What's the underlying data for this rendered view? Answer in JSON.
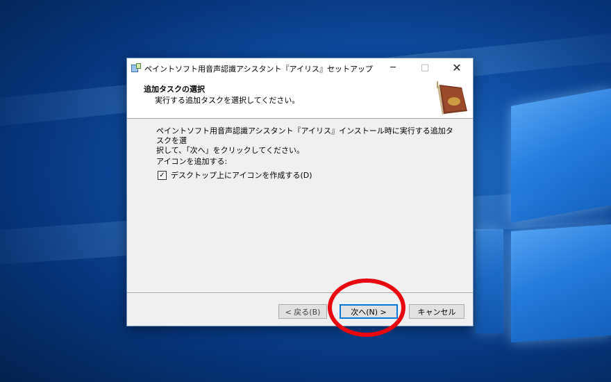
{
  "window": {
    "title": "ペイントソフト用音声認識アシスタント『アイリス』セットアップ",
    "controls": {
      "minimize": "─",
      "maximize": "□",
      "close": "✕"
    }
  },
  "header": {
    "title": "追加タスクの選択",
    "subtitle": "実行する追加タスクを選択してください。"
  },
  "content": {
    "description_line1": "ペイントソフト用音声認識アシスタント『アイリス』インストール時に実行する追加タスクを選",
    "description_line2": "択して、「次へ」をクリックしてください。",
    "section_label": "アイコンを追加する:",
    "checkbox": {
      "label": "デスクトップ上にアイコンを作成する(D)",
      "checked": true,
      "mark": "✓"
    }
  },
  "buttons": {
    "back": "< 戻る(B)",
    "next": "次へ(N) >",
    "cancel": "キャンセル"
  },
  "colors": {
    "accent": "#0078d7",
    "annotation": "#e8070f"
  }
}
